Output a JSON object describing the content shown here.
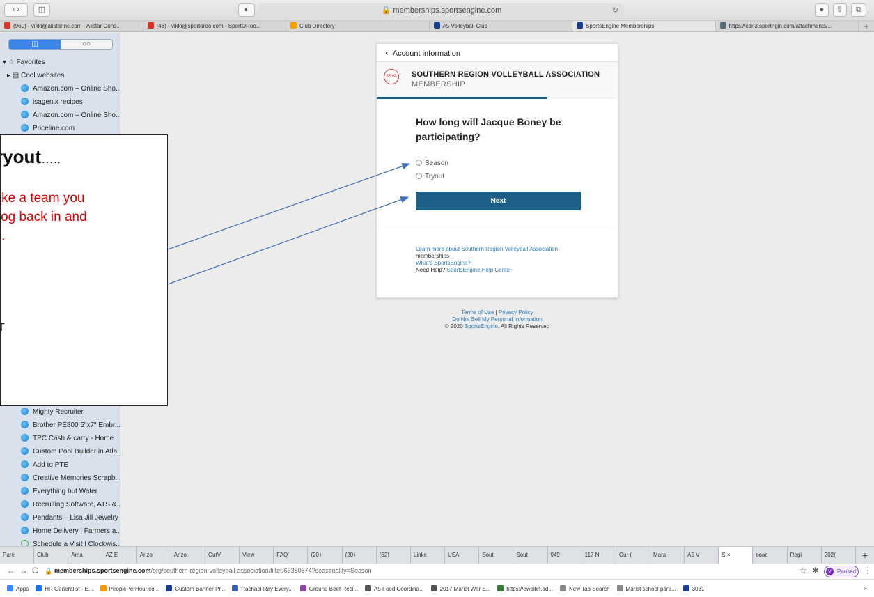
{
  "safari": {
    "url": "memberships.sportsengine.com",
    "reload_glyph": "↻",
    "tabs": [
      {
        "label": "(969) - vikki@alistarinc.com - Alistar Cons...",
        "color": "#d93025"
      },
      {
        "label": "(46) - vikki@sportoroo.com - SportORoo...",
        "color": "#d93025"
      },
      {
        "label": "Club Directory",
        "color": "#f2a300"
      },
      {
        "label": "A5 Volleyball Club",
        "color": "#1b3d8f"
      },
      {
        "label": "SportsEngine Memberships",
        "color": "#1b3d8f",
        "active": true
      },
      {
        "label": "https://cdn3.sportngin.com/attachments/...",
        "color": "#5b6b7d"
      }
    ],
    "new_tab": "+"
  },
  "sidebar": {
    "seg_left": "◫",
    "seg_right": "○○",
    "items": [
      {
        "label": "▾ ☆ Favorites",
        "indent": 4,
        "icon": "none"
      },
      {
        "label": "▸ ▤ Cool websites",
        "indent": 10,
        "icon": "none"
      },
      {
        "label": "Amazon.com – Online Sho...",
        "indent": 30,
        "icon": "globe"
      },
      {
        "label": "isagenix recipes",
        "indent": 30,
        "icon": "globe"
      },
      {
        "label": "Amazon.com – Online Sho...",
        "indent": 30,
        "icon": "globe"
      },
      {
        "label": "Priceline.com",
        "indent": 30,
        "icon": "globe"
      }
    ],
    "items_bottom": [
      {
        "label": "Mighty Recruiter",
        "icon": "globe"
      },
      {
        "label": "Brother PE800 5\"x7\" Embr...",
        "icon": "globe"
      },
      {
        "label": "TPC Cash & carry - Home",
        "icon": "globe"
      },
      {
        "label": "Custom Pool Builder in Atla...",
        "icon": "globe"
      },
      {
        "label": "Add to PTE",
        "icon": "globe"
      },
      {
        "label": "Creative Memories Scrapb...",
        "icon": "globe"
      },
      {
        "label": "Everything but Water",
        "icon": "globe"
      },
      {
        "label": "Recruiting Software, ATS &...",
        "icon": "globe"
      },
      {
        "label": "Pendants – Lisa Jill Jewelry",
        "icon": "globe"
      },
      {
        "label": "Home Delivery | Farmers a...",
        "icon": "globe"
      },
      {
        "label": "Schedule a Visit | Clockwis...",
        "icon": "clock"
      }
    ]
  },
  "card": {
    "back_label": "Account information",
    "back_glyph": "‹",
    "logo_text": "SRVA",
    "org_name": "SOUTHERN REGION VOLLEYBALL ASSOCIATION",
    "org_sub": "MEMBERSHIP",
    "question": "How long will Jacque Boney be participating?",
    "options": [
      "Season",
      "Tryout"
    ],
    "next_label": "Next",
    "links": {
      "learn_more": "Learn more about Southern Region Volleyball Association",
      "memberships": " memberships",
      "whats_se": "What's SportsEngine?",
      "need_help": "Need Help? ",
      "help_center": "SportsEngine Help Center"
    }
  },
  "footer": {
    "terms": "Terms of Use",
    "sep": " | ",
    "privacy": "Privacy Policy",
    "do_not_sell": "Do Not Sell My Personal Information",
    "copy_prefix": "© 2020 ",
    "copy_brand": "SportsEngine",
    "copy_suffix": ", All Rights Reserved"
  },
  "callout": {
    "title": "ryout",
    "title_dots": "…..",
    "body": [
      "nake a team you",
      "o log back in and",
      "on."
    ],
    "extra": "T"
  },
  "chrome": {
    "tabs": [
      "Pare",
      "Club",
      "Ama",
      "AZ E",
      "Arizo",
      "Arizo",
      "OutV",
      "View",
      "FAQ'",
      "(20+",
      "(20+",
      "(62)",
      "Linke",
      "USA",
      "Sout",
      "Sout",
      "949",
      "117 N",
      "Our (",
      "Mara",
      "A5 V",
      "S  ×",
      "coac",
      "Regi",
      "202("
    ],
    "active_index": 21,
    "new_tab": "+",
    "back": "←",
    "forward": "→",
    "reload": "C",
    "lock": "🔒",
    "url_host": "memberships.sportsengine.com",
    "url_path": "/org/southern-region-volleyball-association/filter/63380874?seasonality=Season",
    "star": "☆",
    "puzzle": "✱",
    "avatar": "V",
    "paused": "Paused",
    "menu": "⋮"
  },
  "bookmarks": [
    {
      "label": "Apps",
      "color": "#4285f4"
    },
    {
      "label": "HR Generalist - E...",
      "color": "#1a73e8"
    },
    {
      "label": "PeoplePerHour.co...",
      "color": "#f29900"
    },
    {
      "label": "Custom Banner Pr...",
      "color": "#1a3a8f"
    },
    {
      "label": "Rachael Ray Every...",
      "color": "#3a5fb0"
    },
    {
      "label": "Ground Beef Reci...",
      "color": "#8e44ad"
    },
    {
      "label": "A5 Food Coordina...",
      "color": "#555555"
    },
    {
      "label": "2017 Marist War E...",
      "color": "#555555"
    },
    {
      "label": "https://ewallet.ad...",
      "color": "#2e7d32"
    },
    {
      "label": "New Tab Search",
      "color": "#888888"
    },
    {
      "label": "Marist school pare...",
      "color": "#888888"
    },
    {
      "label": "3031",
      "color": "#1a3a8f"
    }
  ],
  "bookmarks_more": "»"
}
